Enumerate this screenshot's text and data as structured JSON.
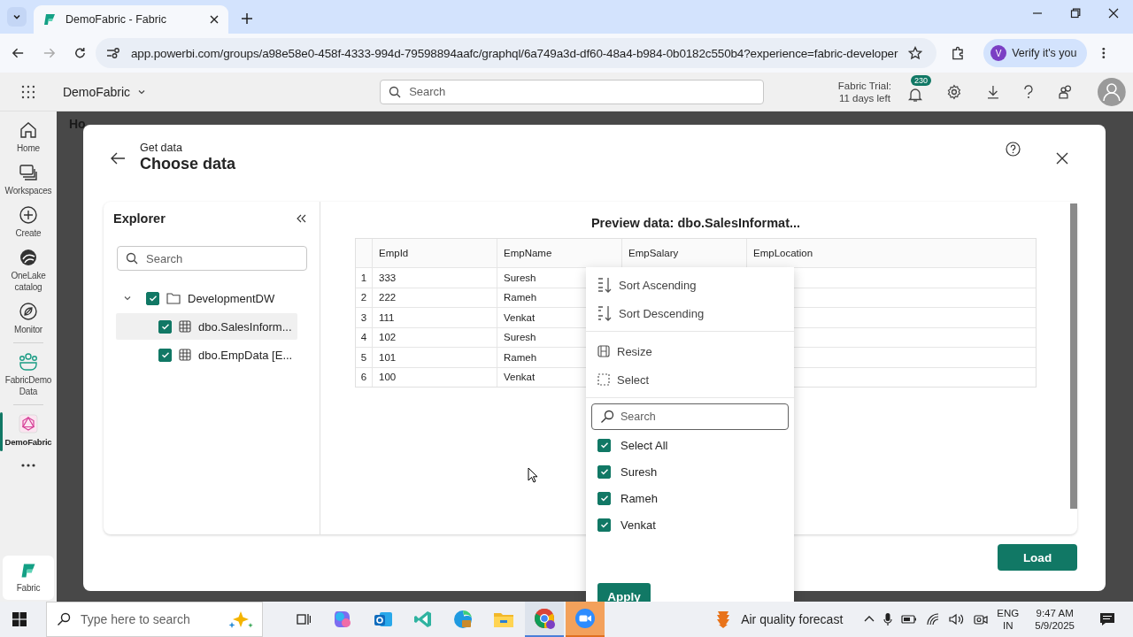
{
  "browser": {
    "tab_title": "DemoFabric - Fabric",
    "url": "app.powerbi.com/groups/a98e58e0-458f-4333-994d-79598894aafc/graphql/6a749a3d-df60-48a4-b984-0b0182c550b4?experience=fabric-developer",
    "profile_initial": "V",
    "profile_button": "Verify it's you"
  },
  "app_bar": {
    "workspace": "DemoFabric",
    "search_placeholder": "Search",
    "trial": [
      "Fabric Trial:",
      "11 days left"
    ],
    "notification_count": "230"
  },
  "nav": [
    {
      "kind": "home",
      "label": "Home",
      "selected": false
    },
    {
      "kind": "workspaces",
      "label": "Workspaces",
      "selected": false
    },
    {
      "kind": "create",
      "label": "Create",
      "selected": false
    },
    {
      "kind": "onelake",
      "label": "OneLake catalog",
      "selected": false
    },
    {
      "kind": "monitor",
      "label": "Monitor",
      "selected": false
    },
    {
      "kind": "divider"
    },
    {
      "kind": "people",
      "label": "FabricDemo Data",
      "selected": false
    },
    {
      "kind": "divider"
    },
    {
      "kind": "graphql",
      "label": "DemoFabric",
      "selected": true
    },
    {
      "kind": "more"
    }
  ],
  "nav_footer": "Fabric",
  "background_tab": "Ho",
  "dialog": {
    "subtitle": "Get data",
    "title": "Choose data",
    "explorer": {
      "title": "Explorer",
      "search_placeholder": "Search",
      "tree": [
        {
          "label": "DevelopmentDW",
          "checked": true,
          "expanded": true,
          "children": [
            {
              "label": "dbo.SalesInform...",
              "checked": true,
              "selected": true
            },
            {
              "label": "dbo.EmpData [E...",
              "checked": true,
              "selected": false
            }
          ]
        }
      ]
    },
    "preview": {
      "title": "Preview data: dbo.SalesInformat...",
      "columns": [
        "EmpId",
        "EmpName",
        "EmpSalary",
        "EmpLocation"
      ],
      "rows": [
        {
          "n": "1",
          "cells": [
            "333",
            "Suresh"
          ]
        },
        {
          "n": "2",
          "cells": [
            "222",
            "Rameh"
          ]
        },
        {
          "n": "3",
          "cells": [
            "111",
            "Venkat"
          ]
        },
        {
          "n": "4",
          "cells": [
            "102",
            "Suresh"
          ]
        },
        {
          "n": "5",
          "cells": [
            "101",
            "Rameh"
          ]
        },
        {
          "n": "6",
          "cells": [
            "100",
            "Venkat"
          ]
        }
      ]
    },
    "load_button": "Load"
  },
  "column_menu": {
    "actions": [
      {
        "kind": "sort-asc",
        "label": "Sort Ascending"
      },
      {
        "kind": "sort-desc",
        "label": "Sort Descending"
      },
      {
        "kind": "resize",
        "label": "Resize"
      },
      {
        "kind": "select",
        "label": "Select"
      }
    ],
    "search_placeholder": "Search",
    "options": [
      {
        "label": "Select All",
        "checked": true
      },
      {
        "label": "Suresh",
        "checked": true
      },
      {
        "label": "Rameh",
        "checked": true
      },
      {
        "label": "Venkat",
        "checked": true
      }
    ],
    "apply_button": "Apply"
  },
  "taskbar": {
    "search_placeholder": "Type here to search",
    "weather": "Air quality forecast",
    "language": [
      "ENG",
      "IN"
    ],
    "time": "9:47 AM",
    "date": "5/9/2025"
  }
}
